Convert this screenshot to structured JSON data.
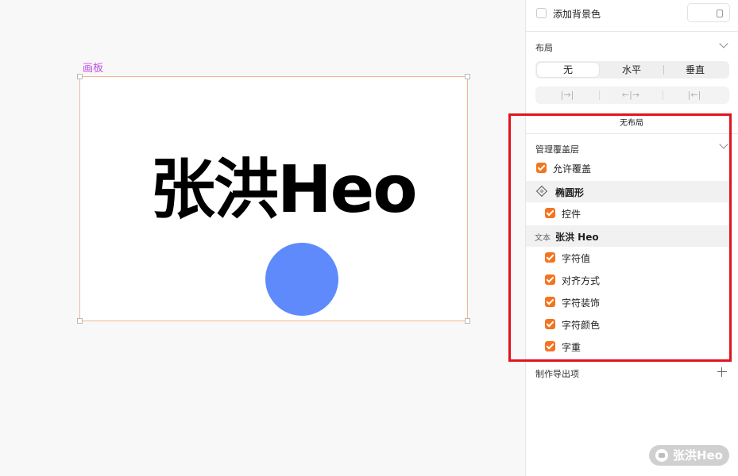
{
  "canvas": {
    "artboard_label": "画板",
    "big_text": "张洪Heo",
    "circle_color": "#5e8afc"
  },
  "inspector": {
    "background": {
      "checkbox_checked": false,
      "label": "添加背景色"
    },
    "layout": {
      "title": "布局",
      "options": [
        "无",
        "水平",
        "垂直"
      ],
      "selected": "无",
      "status": "无布局"
    },
    "overrides": {
      "title": "管理覆盖层",
      "allow_label": "允许覆盖",
      "allow_checked": true,
      "ellipse_name": "椭圆形",
      "ellipse_items": [
        {
          "label": "控件",
          "checked": true
        }
      ],
      "text_tag": "文本",
      "text_name": "张洪 Heo",
      "text_items": [
        {
          "label": "字符值",
          "checked": true
        },
        {
          "label": "对齐方式",
          "checked": true
        },
        {
          "label": "字符装饰",
          "checked": true
        },
        {
          "label": "字符颜色",
          "checked": true
        },
        {
          "label": "字重",
          "checked": true
        }
      ]
    },
    "export": {
      "title": "制作导出项"
    }
  },
  "watermark": "张洪Heo",
  "colors": {
    "accent": "#f5731e",
    "highlight_box": "#e0141e",
    "artboard_label": "#c04fe0"
  }
}
